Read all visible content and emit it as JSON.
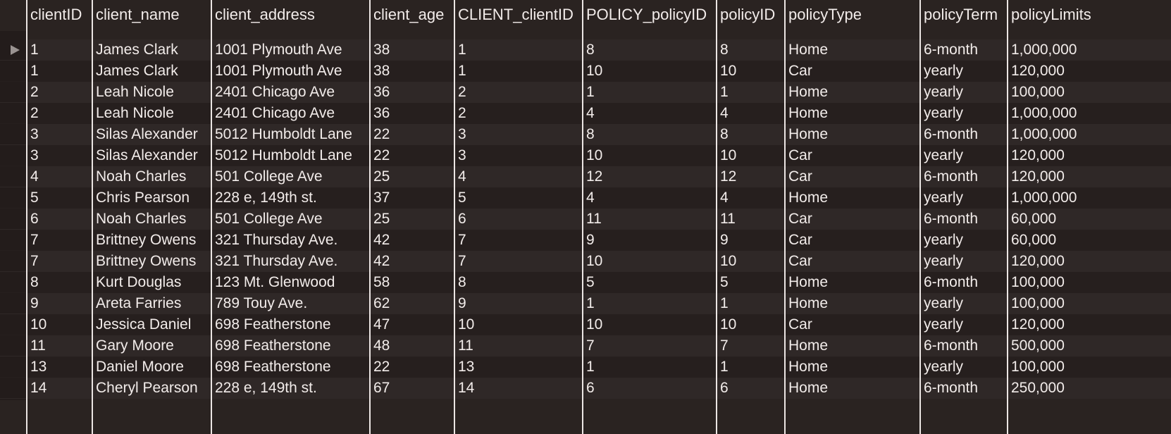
{
  "columns": [
    "clientID",
    "client_name",
    "client_address",
    "client_age",
    "CLIENT_clientID",
    "POLICY_policyID",
    "policyID",
    "policyType",
    "policyTerm",
    "policyLimits"
  ],
  "rows": [
    [
      "1",
      "James Clark",
      "1001 Plymouth Ave",
      "38",
      "1",
      "8",
      "8",
      "Home",
      "6-month",
      "1,000,000"
    ],
    [
      "1",
      "James Clark",
      "1001 Plymouth Ave",
      "38",
      "1",
      "10",
      "10",
      "Car",
      "yearly",
      "120,000"
    ],
    [
      "2",
      "Leah Nicole",
      "2401 Chicago Ave",
      "36",
      "2",
      "1",
      "1",
      "Home",
      "yearly",
      "100,000"
    ],
    [
      "2",
      "Leah Nicole",
      "2401 Chicago Ave",
      "36",
      "2",
      "4",
      "4",
      "Home",
      "yearly",
      "1,000,000"
    ],
    [
      "3",
      "Silas Alexander",
      "5012 Humboldt Lane",
      "22",
      "3",
      "8",
      "8",
      "Home",
      "6-month",
      "1,000,000"
    ],
    [
      "3",
      "Silas Alexander",
      "5012 Humboldt Lane",
      "22",
      "3",
      "10",
      "10",
      "Car",
      "yearly",
      "120,000"
    ],
    [
      "4",
      "Noah Charles",
      "501 College Ave",
      "25",
      "4",
      "12",
      "12",
      "Car",
      "6-month",
      "120,000"
    ],
    [
      "5",
      "Chris Pearson",
      "228 e, 149th st.",
      "37",
      "5",
      "4",
      "4",
      "Home",
      "yearly",
      "1,000,000"
    ],
    [
      "6",
      "Noah Charles",
      "501 College Ave",
      "25",
      "6",
      "11",
      "11",
      "Car",
      "6-month",
      "60,000"
    ],
    [
      "7",
      "Brittney Owens",
      "321 Thursday Ave.",
      "42",
      "7",
      "9",
      "9",
      "Car",
      "yearly",
      "60,000"
    ],
    [
      "7",
      "Brittney Owens",
      "321 Thursday Ave.",
      "42",
      "7",
      "10",
      "10",
      "Car",
      "yearly",
      "120,000"
    ],
    [
      "8",
      "Kurt Douglas",
      "123 Mt. Glenwood",
      "58",
      "8",
      "5",
      "5",
      "Home",
      "6-month",
      "100,000"
    ],
    [
      "9",
      "Areta Farries",
      "789 Touy Ave.",
      "62",
      "9",
      "1",
      "1",
      "Home",
      "yearly",
      "100,000"
    ],
    [
      "10",
      "Jessica Daniel",
      "698 Featherstone",
      "47",
      "10",
      "10",
      "10",
      "Car",
      "yearly",
      "120,000"
    ],
    [
      "11",
      "Gary Moore",
      "698 Featherstone",
      "48",
      "11",
      "7",
      "7",
      "Home",
      "6-month",
      "500,000"
    ],
    [
      "13",
      "Daniel Moore",
      "698 Featherstone",
      "22",
      "13",
      "1",
      "1",
      "Home",
      "yearly",
      "100,000"
    ],
    [
      "14",
      "Cheryl Pearson",
      "228 e, 149th st.",
      "67",
      "14",
      "6",
      "6",
      "Home",
      "6-month",
      "250,000"
    ]
  ],
  "selected_row_marker": "row-pointer-icon",
  "colors": {
    "background": "#2a2321",
    "text": "#f2ecea",
    "grid_line": "#ece6e4"
  }
}
